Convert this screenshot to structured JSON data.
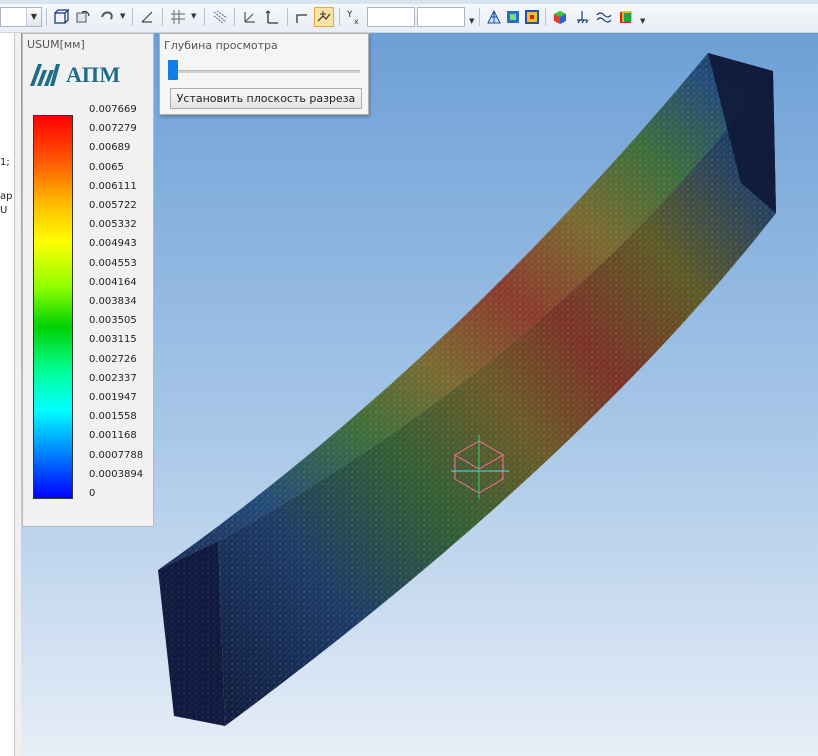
{
  "legend": {
    "title": "USUM[мм]",
    "logo_text": "АПМ",
    "ticks": [
      "0.007669",
      "0.007279",
      "0.00689",
      "0.0065",
      "0.006111",
      "0.005722",
      "0.005332",
      "0.004943",
      "0.004553",
      "0.004164",
      "0.003834",
      "0.003505",
      "0.003115",
      "0.002726",
      "0.002337",
      "0.001947",
      "0.001558",
      "0.001168",
      "0.0007788",
      "0.0003894",
      "0"
    ],
    "gradient_colors": [
      "#ff0000",
      "#ffb400",
      "#ffff00",
      "#00d200",
      "#00ffff",
      "#0090ff",
      "#0000ff"
    ]
  },
  "depth_panel": {
    "label": "Глубина просмотра",
    "slider_value": 0,
    "button_label": "Установить плоскость разреза"
  },
  "toolbar": {
    "accent_active": "#fbe3a6",
    "icons": [
      "view-cube-icon",
      "rotate-icon",
      "undo-icon",
      "plane-icon",
      "grid-icon",
      "hatch-icon",
      "axes-icon",
      "section-icon",
      "probe-icon",
      "yx-axis-icon",
      "mesh-icon",
      "model-icon",
      "results-icon",
      "color-cube-icon",
      "supports-icon",
      "waves-icon",
      "stack-icon"
    ]
  },
  "left_strip": [
    "1;",
    "ар",
    "U"
  ]
}
